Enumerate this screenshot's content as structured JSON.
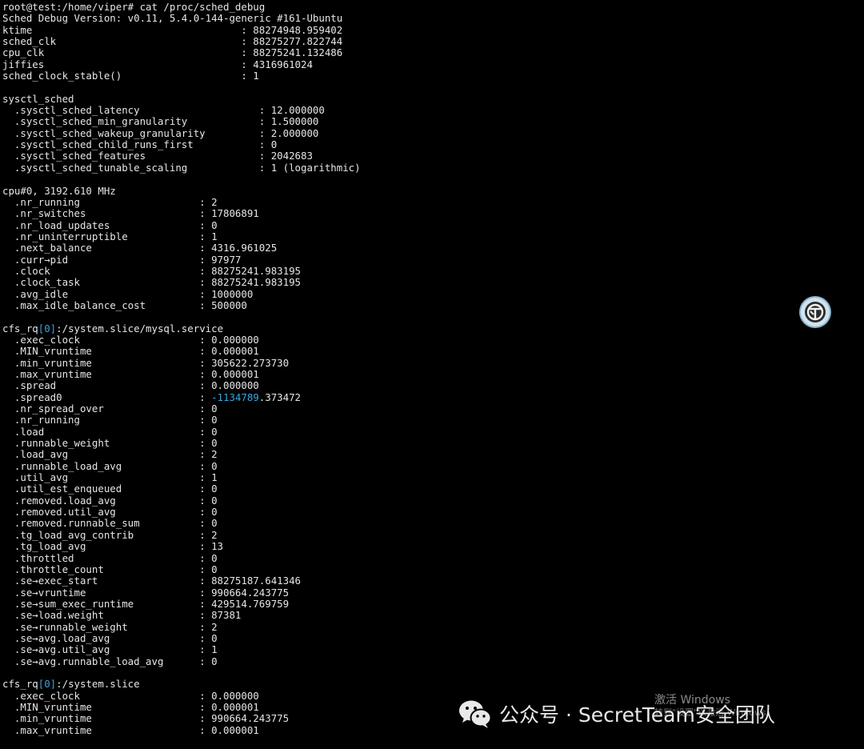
{
  "terminal": {
    "lines": [
      [
        {
          "t": "root@test:/home/viper# cat /proc/sched_debug"
        }
      ],
      [
        {
          "t": "Sched Debug Version: v0.11, 5.4.0-144-generic #161-Ubuntu"
        }
      ],
      [
        {
          "t": "ktime                                   : 88274948.959402"
        }
      ],
      [
        {
          "t": "sched_clk                               : 88275277.822744"
        }
      ],
      [
        {
          "t": "cpu_clk                                 : 88275241.132486"
        }
      ],
      [
        {
          "t": "jiffies                                 : 4316961024"
        }
      ],
      [
        {
          "t": "sched_clock_stable()                    : 1"
        }
      ],
      [
        {
          "t": ""
        }
      ],
      [
        {
          "t": "sysctl_sched"
        }
      ],
      [
        {
          "t": "  .sysctl_sched_latency                    : 12.000000"
        }
      ],
      [
        {
          "t": "  .sysctl_sched_min_granularity            : 1.500000"
        }
      ],
      [
        {
          "t": "  .sysctl_sched_wakeup_granularity         : 2.000000"
        }
      ],
      [
        {
          "t": "  .sysctl_sched_child_runs_first           : 0"
        }
      ],
      [
        {
          "t": "  .sysctl_sched_features                   : 2042683"
        }
      ],
      [
        {
          "t": "  .sysctl_sched_tunable_scaling            : 1 (logarithmic)"
        }
      ],
      [
        {
          "t": ""
        }
      ],
      [
        {
          "t": "cpu#0, 3192.610 MHz"
        }
      ],
      [
        {
          "t": "  .nr_running                    : 2"
        }
      ],
      [
        {
          "t": "  .nr_switches                   : 17806891"
        }
      ],
      [
        {
          "t": "  .nr_load_updates               : 0"
        }
      ],
      [
        {
          "t": "  .nr_uninterruptible            : 1"
        }
      ],
      [
        {
          "t": "  .next_balance                  : 4316.961025"
        }
      ],
      [
        {
          "t": "  .curr→pid                      : 97977"
        }
      ],
      [
        {
          "t": "  .clock                         : 88275241.983195"
        }
      ],
      [
        {
          "t": "  .clock_task                    : 88275241.983195"
        }
      ],
      [
        {
          "t": "  .avg_idle                      : 1000000"
        }
      ],
      [
        {
          "t": "  .max_idle_balance_cost         : 500000"
        }
      ],
      [
        {
          "t": ""
        }
      ],
      [
        {
          "t": "cfs_rq"
        },
        {
          "t": "[0]",
          "c": "cyan"
        },
        {
          "t": ":/system.slice/mysql.service"
        }
      ],
      [
        {
          "t": "  .exec_clock                    : 0.000000"
        }
      ],
      [
        {
          "t": "  .MIN_vruntime                  : 0.000001"
        }
      ],
      [
        {
          "t": "  .min_vruntime                  : 305622.273730"
        }
      ],
      [
        {
          "t": "  .max_vruntime                  : 0.000001"
        }
      ],
      [
        {
          "t": "  .spread                        : 0.000000"
        }
      ],
      [
        {
          "t": "  .spread0                       : "
        },
        {
          "t": "-1134789",
          "c": "cyan"
        },
        {
          "t": ".373472"
        }
      ],
      [
        {
          "t": "  .nr_spread_over                : 0"
        }
      ],
      [
        {
          "t": "  .nr_running                    : 0"
        }
      ],
      [
        {
          "t": "  .load                          : 0"
        }
      ],
      [
        {
          "t": "  .runnable_weight               : 0"
        }
      ],
      [
        {
          "t": "  .load_avg                      : 2"
        }
      ],
      [
        {
          "t": "  .runnable_load_avg             : 0"
        }
      ],
      [
        {
          "t": "  .util_avg                      : 1"
        }
      ],
      [
        {
          "t": "  .util_est_enqueued             : 0"
        }
      ],
      [
        {
          "t": "  .removed.load_avg              : 0"
        }
      ],
      [
        {
          "t": "  .removed.util_avg              : 0"
        }
      ],
      [
        {
          "t": "  .removed.runnable_sum          : 0"
        }
      ],
      [
        {
          "t": "  .tg_load_avg_contrib           : 2"
        }
      ],
      [
        {
          "t": "  .tg_load_avg                   : 13"
        }
      ],
      [
        {
          "t": "  .throttled                     : 0"
        }
      ],
      [
        {
          "t": "  .throttle_count                : 0"
        }
      ],
      [
        {
          "t": "  .se→exec_start                 : 88275187.641346"
        }
      ],
      [
        {
          "t": "  .se→vruntime                   : 990664.243775"
        }
      ],
      [
        {
          "t": "  .se→sum_exec_runtime           : 429514.769759"
        }
      ],
      [
        {
          "t": "  .se→load.weight                : 87381"
        }
      ],
      [
        {
          "t": "  .se→runnable_weight            : 2"
        }
      ],
      [
        {
          "t": "  .se→avg.load_avg               : 0"
        }
      ],
      [
        {
          "t": "  .se→avg.util_avg               : 1"
        }
      ],
      [
        {
          "t": "  .se→avg.runnable_load_avg      : 0"
        }
      ],
      [
        {
          "t": ""
        }
      ],
      [
        {
          "t": "cfs_rq"
        },
        {
          "t": "[0]",
          "c": "cyan"
        },
        {
          "t": ":/system.slice"
        }
      ],
      [
        {
          "t": "  .exec_clock                    : 0.000000"
        }
      ],
      [
        {
          "t": "  .MIN_vruntime                  : 0.000001"
        }
      ],
      [
        {
          "t": "  .min_vruntime                  : 990664.243775"
        }
      ],
      [
        {
          "t": "  .max_vruntime                  : 0.000001"
        }
      ]
    ]
  },
  "activation": {
    "title": "激活 Windows",
    "subtitle": "转到\"设置\"以激活 Windows。"
  },
  "watermark": {
    "text": "公众号 · SecretTeam安全团队",
    "icon": "wechat-icon"
  },
  "widget": {
    "icon": "floating-assistant-icon"
  },
  "colors": {
    "background": "#000000",
    "text": "#e6e6e6",
    "highlight": "#3aa6df"
  }
}
